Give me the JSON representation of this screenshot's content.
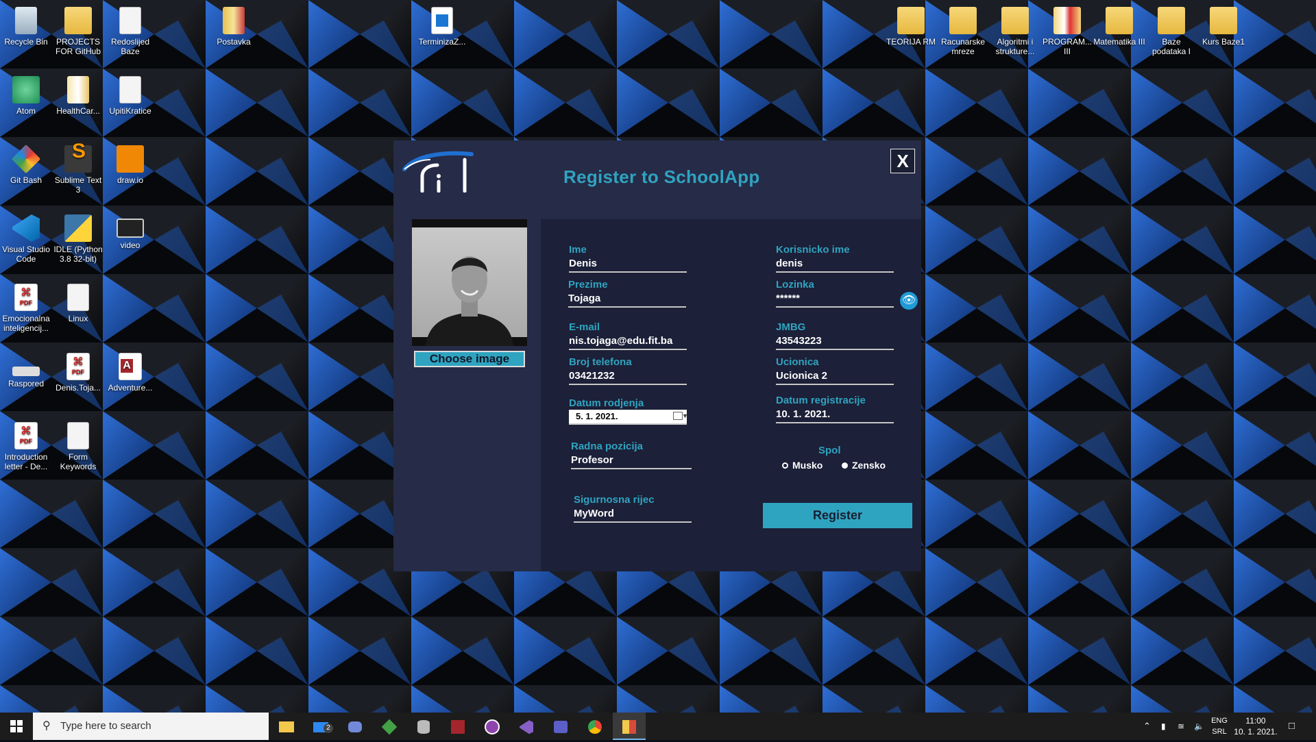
{
  "desktop": {
    "icons": [
      {
        "label": "Recycle Bin",
        "icon": "recycle-bin-icon"
      },
      {
        "label": "PROJECTS FOR GitHub",
        "icon": "folder-icon"
      },
      {
        "label": "Redoslijed Baze",
        "icon": "document-icon"
      },
      {
        "label": "Postavka",
        "icon": "archive-icon"
      },
      {
        "label": "TerminizaZ...",
        "icon": "calendar-file-icon"
      },
      {
        "label": "Atom",
        "icon": "atom-icon"
      },
      {
        "label": "HealthCar...",
        "icon": "folder-icon"
      },
      {
        "label": "UpitiKratice",
        "icon": "document-icon"
      },
      {
        "label": "Git Bash",
        "icon": "git-icon"
      },
      {
        "label": "Sublime Text 3",
        "icon": "sublime-icon"
      },
      {
        "label": "draw.io",
        "icon": "drawio-icon"
      },
      {
        "label": "Visual Studio Code",
        "icon": "vscode-icon"
      },
      {
        "label": "IDLE (Python 3.8 32-bit)",
        "icon": "python-icon"
      },
      {
        "label": "video",
        "icon": "video-icon"
      },
      {
        "label": "Emocionalna inteligencij...",
        "icon": "pdf-icon"
      },
      {
        "label": "Linux",
        "icon": "document-icon"
      },
      {
        "label": "Raspored",
        "icon": "image-file-icon"
      },
      {
        "label": "Denis.Toja...",
        "icon": "pdf-icon"
      },
      {
        "label": "Adventure...",
        "icon": "access-icon"
      },
      {
        "label": "Introduction letter - De...",
        "icon": "pdf-icon"
      },
      {
        "label": "Form Keywords",
        "icon": "document-icon"
      },
      {
        "label": "TEORIJA RM",
        "icon": "folder-icon"
      },
      {
        "label": "Racunarske mreze",
        "icon": "folder-icon"
      },
      {
        "label": "Algoritmi i strukture...",
        "icon": "folder-icon"
      },
      {
        "label": "PROGRAM... III",
        "icon": "pdf-folder-icon"
      },
      {
        "label": "Matematika III",
        "icon": "folder-icon"
      },
      {
        "label": "Baze podataka I",
        "icon": "folder-icon"
      },
      {
        "label": "Kurs Baze1",
        "icon": "folder-icon"
      }
    ]
  },
  "dialog": {
    "title": "Register to SchoolApp",
    "close_label": "X",
    "choose_image_label": "Choose image",
    "register_label": "Register",
    "fields": {
      "ime": {
        "label": "Ime",
        "value": "Denis"
      },
      "prezime": {
        "label": "Prezime",
        "value": "Tojaga"
      },
      "email": {
        "label": "E-mail",
        "value": "nis.tojaga@edu.fit.ba"
      },
      "telefon": {
        "label": "Broj telefona",
        "value": "03421232"
      },
      "datum_rodjenja": {
        "label": "Datum rodjenja",
        "value": "5.   1. 2021."
      },
      "radna_pozicija": {
        "label": "Radna pozicija",
        "value": "Profesor"
      },
      "sigurnosna_rijec": {
        "label": "Sigurnosna rijec",
        "value": "MyWord"
      },
      "korisnicko_ime": {
        "label": "Korisnicko ime",
        "value": "denis"
      },
      "lozinka": {
        "label": "Lozinka",
        "value": "******"
      },
      "jmbg": {
        "label": "JMBG",
        "value": "43543223"
      },
      "ucionica": {
        "label": "Ucionica",
        "value": "Ucionica 2"
      },
      "datum_registracije": {
        "label": "Datum registracije",
        "value": "10. 1. 2021."
      }
    },
    "spol": {
      "label": "Spol",
      "options": [
        "Musko",
        "Zensko"
      ],
      "selected": "Zensko"
    },
    "accent_color": "#2fa4c0"
  },
  "taskbar": {
    "search_placeholder": "Type here to search",
    "mail_badge": "2",
    "language": "ENG",
    "layout": "SRL",
    "time": "11:00",
    "date": "10. 1. 2021."
  }
}
